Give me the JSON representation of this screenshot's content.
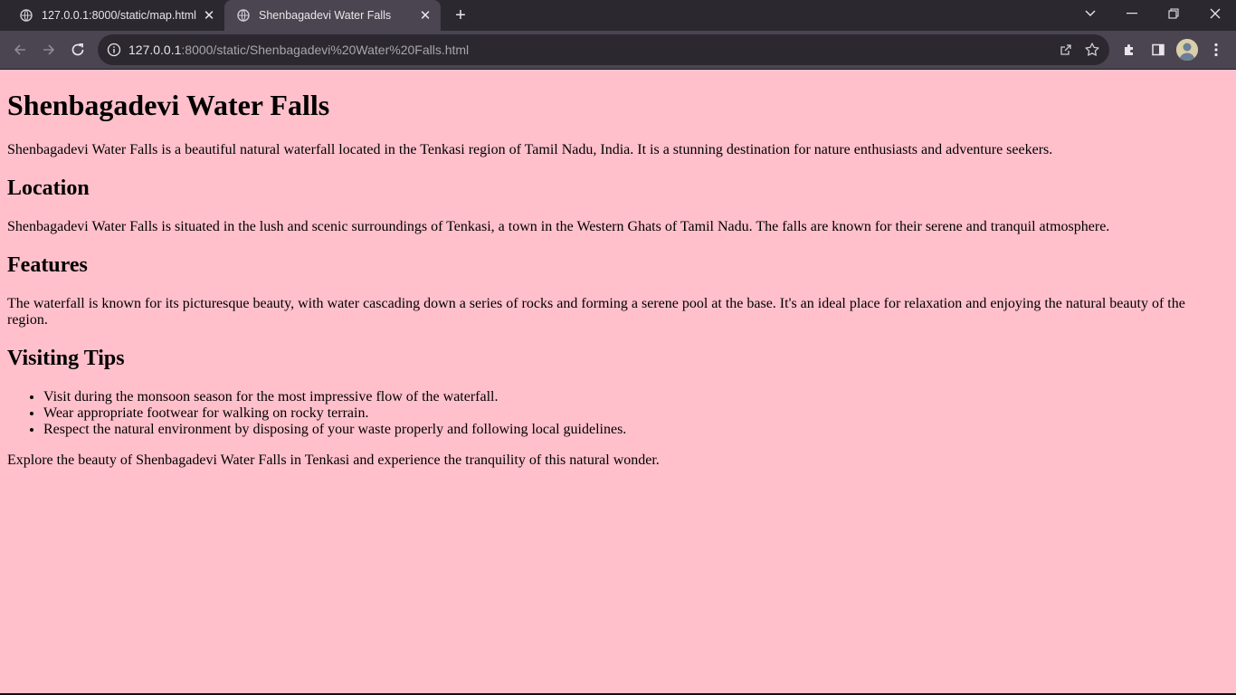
{
  "browser": {
    "tabs": [
      {
        "title": "127.0.0.1:8000/static/map.html",
        "active": false
      },
      {
        "title": "Shenbagadevi Water Falls",
        "active": true
      }
    ],
    "url_host": "127.0.0.1",
    "url_path": ":8000/static/Shenbagadevi%20Water%20Falls.html",
    "close_glyph": "✕",
    "newtab_glyph": "+"
  },
  "page": {
    "title": "Shenbagadevi Water Falls",
    "intro": "Shenbagadevi Water Falls is a beautiful natural waterfall located in the Tenkasi region of Tamil Nadu, India. It is a stunning destination for nature enthusiasts and adventure seekers.",
    "location_heading": "Location",
    "location_text": "Shenbagadevi Water Falls is situated in the lush and scenic surroundings of Tenkasi, a town in the Western Ghats of Tamil Nadu. The falls are known for their serene and tranquil atmosphere.",
    "features_heading": "Features",
    "features_text": "The waterfall is known for its picturesque beauty, with water cascading down a series of rocks and forming a serene pool at the base. It's an ideal place for relaxation and enjoying the natural beauty of the region.",
    "tips_heading": "Visiting Tips",
    "tips": [
      "Visit during the monsoon season for the most impressive flow of the waterfall.",
      "Wear appropriate footwear for walking on rocky terrain.",
      "Respect the natural environment by disposing of your waste properly and following local guidelines."
    ],
    "outro": "Explore the beauty of Shenbagadevi Water Falls in Tenkasi and experience the tranquility of this natural wonder."
  },
  "colors": {
    "page_background": "#ffc0cb",
    "tabstrip": "#2b2830",
    "toolbar": "#4a4550",
    "omnibox": "#2b2830"
  }
}
